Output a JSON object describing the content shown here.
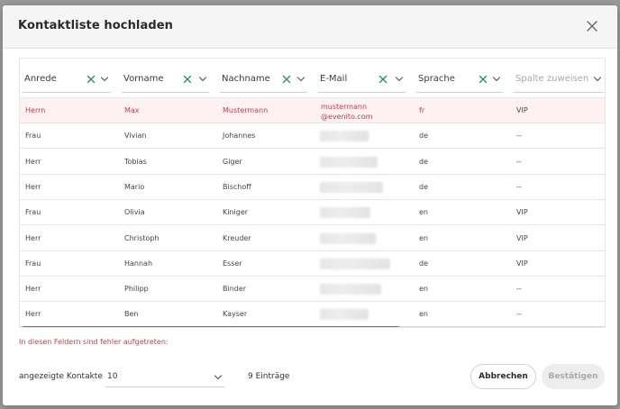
{
  "dialog": {
    "title": "Kontaktliste hochladen"
  },
  "columns": [
    {
      "label": "Anrede",
      "placeholder": false,
      "clearable": true
    },
    {
      "label": "Vorname",
      "placeholder": false,
      "clearable": true
    },
    {
      "label": "Nachname",
      "placeholder": false,
      "clearable": true
    },
    {
      "label": "E-Mail",
      "placeholder": false,
      "clearable": true
    },
    {
      "label": "Sprache",
      "placeholder": false,
      "clearable": true
    },
    {
      "label": "Spalte zuweisen",
      "placeholder": true,
      "clearable": false
    }
  ],
  "rows": [
    {
      "anrede": "Herrn",
      "vorname": "Max",
      "nachname": "Mustermann",
      "email_line1": "mustermann",
      "email_line2": "@evenito.com",
      "sprache": "fr",
      "extra": "VIP",
      "error": true,
      "email_redacted": false
    },
    {
      "anrede": "Frau",
      "vorname": "Vivian",
      "nachname": "Johannes",
      "sprache": "de",
      "extra": "--",
      "error": false,
      "email_redacted": true
    },
    {
      "anrede": "Herr",
      "vorname": "Tobias",
      "nachname": "Giger",
      "sprache": "de",
      "extra": "--",
      "error": false,
      "email_redacted": true
    },
    {
      "anrede": "Herr",
      "vorname": "Mario",
      "nachname": "Bischoff",
      "sprache": "de",
      "extra": "--",
      "error": false,
      "email_redacted": true
    },
    {
      "anrede": "Frau",
      "vorname": "Olivia",
      "nachname": "Kiniger",
      "sprache": "en",
      "extra": "VIP",
      "error": false,
      "email_redacted": true
    },
    {
      "anrede": "Herr",
      "vorname": "Christoph",
      "nachname": "Kreuder",
      "sprache": "en",
      "extra": "VIP",
      "error": false,
      "email_redacted": true
    },
    {
      "anrede": "Frau",
      "vorname": "Hannah",
      "nachname": "Esser",
      "sprache": "de",
      "extra": "VIP",
      "error": false,
      "email_redacted": true
    },
    {
      "anrede": "Herr",
      "vorname": "Philipp",
      "nachname": "Binder",
      "sprache": "en",
      "extra": "--",
      "error": false,
      "email_redacted": true
    },
    {
      "anrede": "Herr",
      "vorname": "Ben",
      "nachname": "Kayser",
      "sprache": "en",
      "extra": "--",
      "error": false,
      "email_redacted": true
    }
  ],
  "error_message": "In diesen Feldern sind fehler aufgetreten:",
  "footer": {
    "shown_contacts_label": "angezeigte Kontakte",
    "page_size": "10",
    "entries_text": "9 Einträge",
    "cancel_label": "Abbrechen",
    "confirm_label": "Bestätigen"
  },
  "colors": {
    "accent_green": "#2f8f6b",
    "error_red": "#c83c4c",
    "error_row_bg": "#fdf1f2"
  },
  "icons": {
    "close": "close-icon",
    "clear": "clear-x-icon",
    "dropdown": "chevron-down-icon"
  }
}
